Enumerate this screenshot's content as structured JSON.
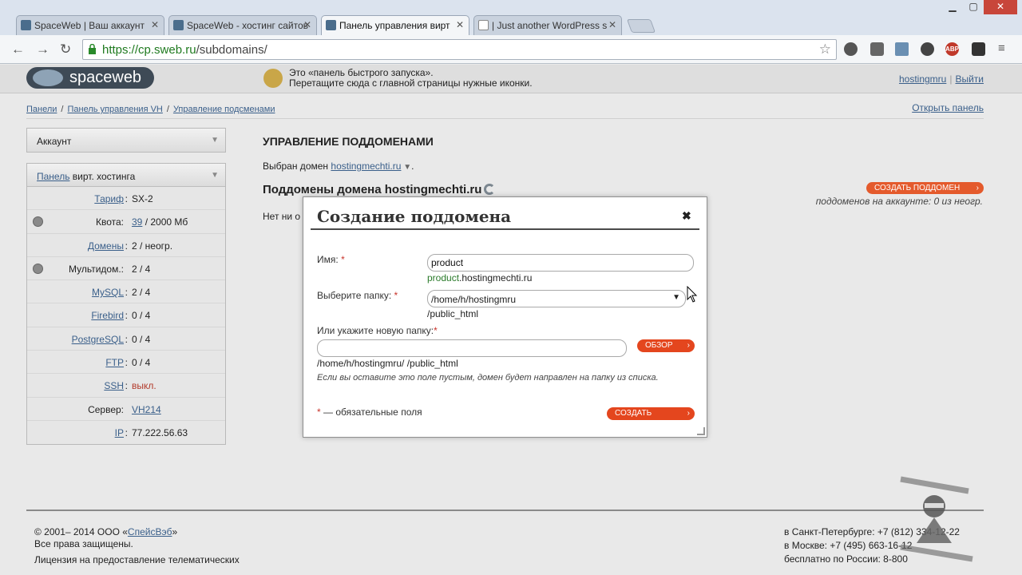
{
  "browser": {
    "tabs": [
      {
        "title": "SpaceWeb | Ваш аккаунт",
        "active": false
      },
      {
        "title": "SpaceWeb - хостинг сайтов",
        "active": false
      },
      {
        "title": "Панель управления вирт",
        "active": true
      },
      {
        "title": "| Just another WordPress s",
        "active": false
      }
    ],
    "url_host": "https://cp.sweb.ru",
    "url_path": "/subdomains/",
    "extensions": [
      "clock-icon",
      "puzzle-icon",
      "folder-icon",
      "ring-icon",
      "adblock-icon",
      "owl-icon"
    ],
    "adblock_label": "ABP"
  },
  "header": {
    "logo_text": "spaceweb",
    "quick_launch_line1": "Это «панель быстрого запуска».",
    "quick_launch_line2": "Перетащите сюда с главной страницы нужные иконки.",
    "user": "hostingmru",
    "logout": "Выйти"
  },
  "breadcrumbs": [
    "Панели",
    "Панель управления VH",
    "Управление подсменами"
  ],
  "breadcrumb_sep": "/",
  "open_panel": "Открыть панель",
  "sidebar": {
    "account_label": "Аккаунт",
    "panel_link": "Панель",
    "panel_rest": " вирт. хостинга",
    "rows": [
      {
        "k": "Тариф",
        "v": "SX-2",
        "link": true,
        "q": false
      },
      {
        "k": "Квота:",
        "v_link": "39",
        "v": " / 2000 Мб",
        "link": false,
        "q": true
      },
      {
        "k": "Домены",
        "v": "2 / неогр.",
        "link": true,
        "q": false
      },
      {
        "k": "Мультидом.:",
        "v": "2 / 4",
        "link": false,
        "q": true
      },
      {
        "k": "MySQL",
        "v": "2 / 4",
        "link": true,
        "q": false
      },
      {
        "k": "Firebird",
        "v": "0 / 4",
        "link": true,
        "q": false
      },
      {
        "k": "PostgreSQL",
        "v": "0 / 4",
        "link": true,
        "q": false
      },
      {
        "k": "FTP",
        "v": "0 / 4",
        "link": true,
        "q": false
      },
      {
        "k": "SSH",
        "v": "выкл.",
        "link": true,
        "q": false,
        "red": true
      },
      {
        "k": "Сервер:",
        "v": "VH214",
        "link": false,
        "q": false,
        "vlink": true
      },
      {
        "k": "IP",
        "v": "77.222.56.63",
        "link": true,
        "q": false
      }
    ]
  },
  "main": {
    "title": "УПРАВЛЕНИЕ ПОДДОМЕНАМИ",
    "chosen_prefix": "Выбран домен",
    "chosen_domain": "hostingmechti.ru",
    "subtitle": "Поддомены домена hostingmechti.ru",
    "none_text": "Нет ни о",
    "create_button": "СОЗДАТЬ ПОДДОМЕН",
    "quota_text": "поддоменов на аккаунте: 0 из неогр."
  },
  "modal": {
    "title": "Создание поддомена",
    "name_label": "Имя:",
    "name_value": "product",
    "name_hint_green": "product",
    "name_hint_rest": ".hostingmechti.ru",
    "folder_label": "Выберите папку:",
    "folder_value": "/home/h/hostingmru",
    "folder_hint": "/public_html",
    "newfolder_label": "Или укажите новую папку:",
    "newfolder_value": "",
    "browse_button": "ОБЗОР",
    "newfolder_hint": "/home/h/hostingmru/ /public_html",
    "note": "Если вы оставите это поле пустым, домен будет направлен на папку из списка.",
    "required_note": "— обязательные поля",
    "submit_button": "СОЗДАТЬ",
    "required_mark": "*"
  },
  "footer": {
    "copyright_prefix": "© 2001– 2014 ООО «",
    "company": "СпейсВэб",
    "copyright_suffix": "»",
    "rights": "Все права защищены.",
    "license": "Лицензия на предоставление телематических",
    "spb": "в Санкт-Петербурге: +7 (812) 334-12-22",
    "msk": "в Москве: +7 (495) 663-16-12",
    "free": "бесплатно по России: 8-800"
  }
}
